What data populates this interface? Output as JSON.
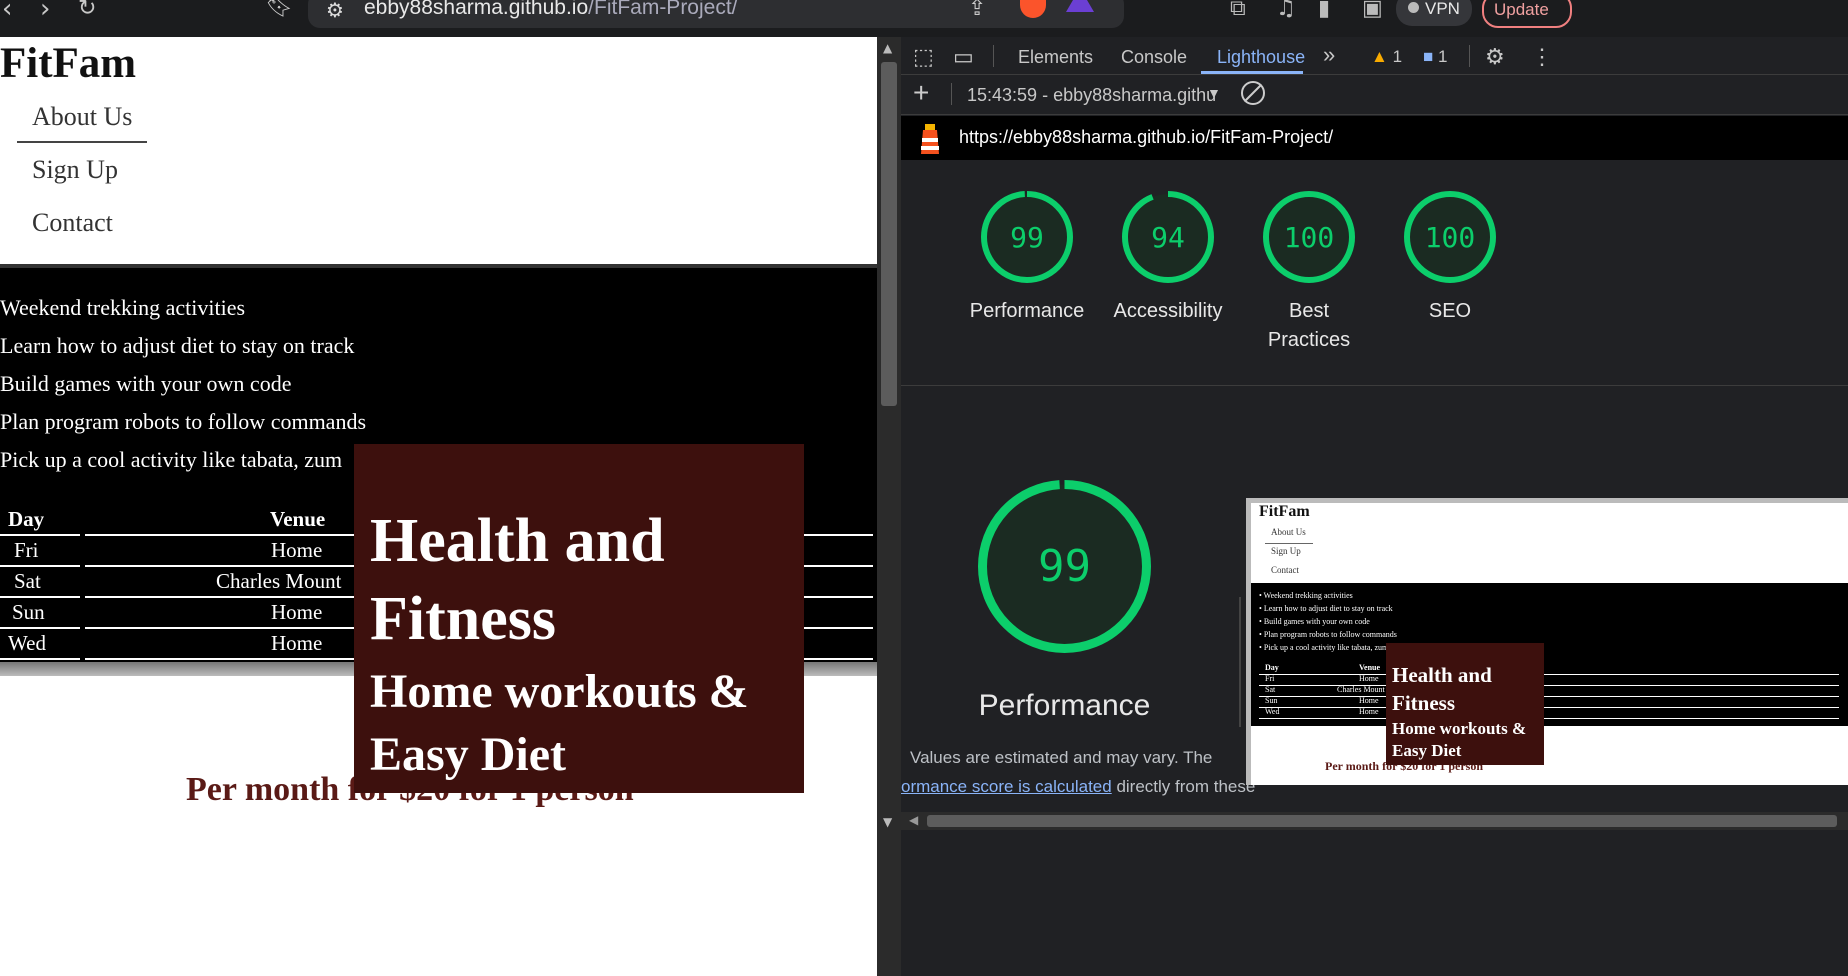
{
  "browser": {
    "url_host": "ebby88sharma.github.io",
    "url_path": "/FitFam-Project/",
    "vpn_label": "VPN",
    "update_label": "Update",
    "icons": [
      "back-icon",
      "forward-icon",
      "reload-icon",
      "bookmark-icon",
      "site-settings-icon",
      "share-icon",
      "brave-shield-icon",
      "brave-rewards-icon",
      "extensions-icon",
      "media-icon",
      "sidebar-icon",
      "wallet-icon"
    ]
  },
  "site": {
    "logo": "FitFam",
    "nav": [
      "About Us",
      "Sign Up",
      "Contact"
    ],
    "activities": [
      "Weekend trekking activities",
      "Learn how to adjust diet to stay on track",
      "Build games with your own code",
      "Plan program robots to follow commands",
      "Pick up a cool activity like tabata, zum"
    ],
    "schedule_headers": [
      "Day",
      "Venue"
    ],
    "schedule_rows": [
      {
        "day": "Fri",
        "venue": "Home"
      },
      {
        "day": "Sat",
        "venue": "Charles Mount"
      },
      {
        "day": "Sun",
        "venue": "Home"
      },
      {
        "day": "Wed",
        "venue": "Home"
      }
    ],
    "hero_line1": "Health and",
    "hero_line2": "Fitness",
    "hero_line3": "Home workouts &",
    "hero_line4": "Easy Diet",
    "price": "Per month for $20 for 1 person",
    "hero_color": "#3d100d"
  },
  "devtools": {
    "tabs": [
      "Elements",
      "Console",
      "Lighthouse"
    ],
    "active_tab": "Lighthouse",
    "warnings_count": "1",
    "messages_count": "1",
    "report_selector": "15:43:59 - ebby88sharma.githu",
    "report_url": "https://ebby88sharma.github.io/FitFam-Project/",
    "scores": [
      {
        "label": "Performance",
        "value": 99
      },
      {
        "label": "Accessibility",
        "value": 94
      },
      {
        "label": "Best\nPractices",
        "value": 100
      },
      {
        "label": "SEO",
        "value": 100
      }
    ],
    "big_score": {
      "label": "Performance",
      "value": 99
    },
    "note_line1": "Values are estimated and may vary. The",
    "note_link": "ormance score is calculated",
    "note_line2_rest": " directly from these",
    "score_color": "#0cce6b"
  }
}
